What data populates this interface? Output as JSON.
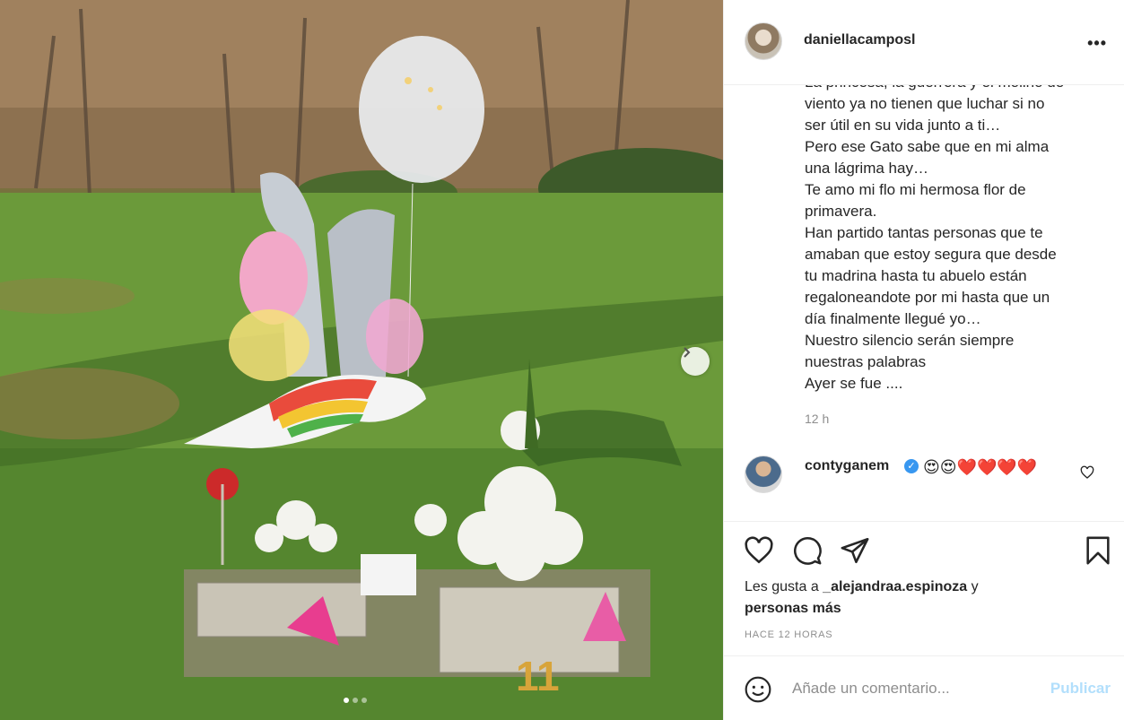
{
  "post": {
    "username": "daniellacamposl",
    "more_label": "•••"
  },
  "photo": {
    "description_icons": [
      "balloon",
      "flowers",
      "grave-plaque"
    ],
    "next_icon": "chevron-right-icon"
  },
  "caption": {
    "lines": [
      "La princesa, la guerrera y el molino de",
      "viento ya no tienen que luchar si no",
      "ser útil en su vida junto a ti…",
      "Pero ese Gato sabe que en mi alma",
      "una lágrima hay…",
      "Te amo mi flo mi hermosa flor de",
      "primavera.",
      "Han partido tantas personas que te",
      "amaban que estoy segura que desde",
      "tu madrina hasta tu abuelo están",
      "regaloneandote por mi hasta que un",
      "día finalmente llegué yo…",
      "Nuestro silencio serán siempre",
      "nuestras palabras",
      "Ayer se fue ...."
    ],
    "time": "12 h"
  },
  "comment": {
    "username": "contyganem",
    "text": "😍😍❤️❤️❤️❤️"
  },
  "likes": {
    "prefix": "Les gusta a ",
    "user": "_alejandraa.espinoza",
    "conjunction": " y",
    "others": "personas más"
  },
  "posted_ago": "HACE 12 HORAS",
  "add_comment": {
    "placeholder": "Añade un comentario...",
    "publish_label": "Publicar"
  },
  "colors": {
    "text": "#262626",
    "muted": "#8e8e8e",
    "publish_disabled": "#b2dffc",
    "verified": "#3897f0",
    "heart": "#ed4956"
  }
}
